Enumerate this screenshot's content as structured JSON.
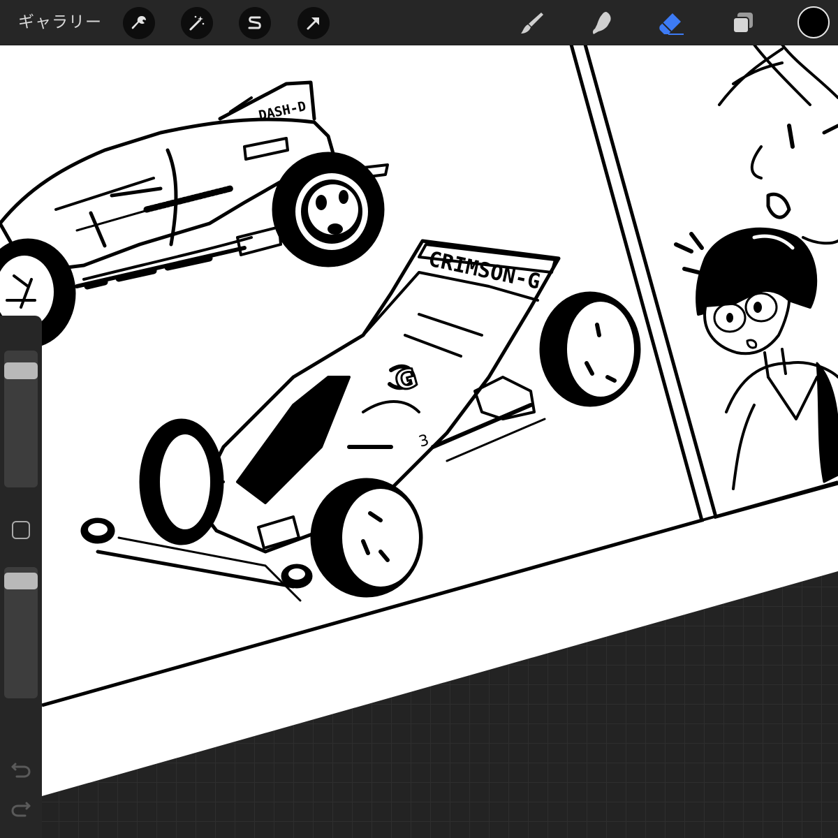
{
  "toolbar": {
    "gallery_label": "ギャラリー",
    "left_tools": [
      {
        "name": "actions",
        "icon": "wrench-icon"
      },
      {
        "name": "adjustments",
        "icon": "magic-wand-icon"
      },
      {
        "name": "selection",
        "icon": "selection-s-icon"
      },
      {
        "name": "transform",
        "icon": "arrow-cursor-icon"
      }
    ],
    "right_tools": [
      {
        "name": "brush",
        "icon": "brush-icon",
        "active": false
      },
      {
        "name": "smudge",
        "icon": "smudge-finger-icon",
        "active": false
      },
      {
        "name": "eraser",
        "icon": "eraser-icon",
        "active": true
      },
      {
        "name": "layers",
        "icon": "layers-icon",
        "active": false
      }
    ],
    "active_color": "#000000",
    "accent_color": "#3d7bf5"
  },
  "sidebar": {
    "size_slider_value": 0.1,
    "opacity_slider_value": 0.0,
    "undo_icon": "undo-arrow-icon",
    "redo_icon": "redo-arrow-icon",
    "modify_icon": "square-modify-icon"
  },
  "canvas": {
    "car_label_1": "DASH-D",
    "car_label_2": "CRIMSON-G",
    "car_number": "3",
    "car_emblem": "G"
  }
}
